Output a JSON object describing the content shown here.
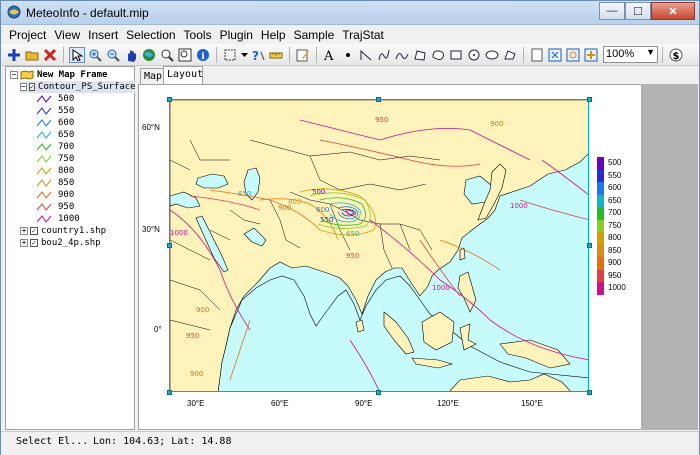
{
  "window": {
    "title": "MeteoInfo - default.mip",
    "buttons": {
      "minimize": "—",
      "maximize": "☐",
      "close": "✕"
    }
  },
  "menu": [
    "Project",
    "View",
    "Insert",
    "Selection",
    "Tools",
    "Plugin",
    "Help",
    "Sample",
    "TrajStat"
  ],
  "toolbar": {
    "zoom_value": "100%",
    "icons": [
      "add-layer-icon",
      "open-icon",
      "remove-layer-icon",
      "select-icon",
      "zoom-in-icon",
      "zoom-out-icon",
      "pan-icon",
      "full-extent-icon",
      "zoom-layer-icon",
      "zoom-select-icon",
      "identify-icon",
      "select-box-icon",
      "dropdown-icon",
      "help-icon",
      "measure-icon",
      "edit-icon",
      "text-icon",
      "point-icon",
      "polyline-icon",
      "freehand-icon",
      "curve-icon",
      "polygon-icon",
      "curve-polygon-icon",
      "rectangle-icon",
      "circle-icon",
      "ellipse-icon",
      "page-setup-icon",
      "page-fit-icon",
      "page-zoom-icon",
      "page-pan-icon",
      "dollar-icon"
    ]
  },
  "legend_tree": {
    "map_frame": "New Map Frame",
    "layers": [
      {
        "name": "Contour_PS_Surface_",
        "selected": true
      },
      {
        "name": "country1.shp",
        "selected": false
      },
      {
        "name": "bou2_4p.shp",
        "selected": false
      }
    ],
    "contour_levels": [
      {
        "value": "500",
        "color": "#7000c0"
      },
      {
        "value": "550",
        "color": "#2a2ad8"
      },
      {
        "value": "600",
        "color": "#1a7ce8"
      },
      {
        "value": "650",
        "color": "#12b8c8"
      },
      {
        "value": "700",
        "color": "#20c020"
      },
      {
        "value": "750",
        "color": "#88cc20"
      },
      {
        "value": "800",
        "color": "#d0a000"
      },
      {
        "value": "850",
        "color": "#e08a10"
      },
      {
        "value": "900",
        "color": "#e07010"
      },
      {
        "value": "950",
        "color": "#e04040"
      },
      {
        "value": "1000",
        "color": "#d0108a"
      }
    ]
  },
  "tabs": {
    "map": "Map",
    "layout": "Layout"
  },
  "map": {
    "lat_labels": [
      "60°N",
      "30°N",
      "0°"
    ],
    "lon_labels": [
      "30°E",
      "60°E",
      "90°E",
      "120°E",
      "150°E"
    ],
    "contour_labels": [
      "950",
      "900",
      "650",
      "500",
      "600",
      "800",
      "900",
      "550",
      "650",
      "950",
      "1000",
      "1000",
      "900",
      "950",
      "900",
      "1000"
    ],
    "colorbar": {
      "labels": [
        "500",
        "550",
        "600",
        "650",
        "700",
        "750",
        "800",
        "850",
        "900",
        "950",
        "1000"
      ],
      "colors": [
        "#7000c0",
        "#2a2ad8",
        "#1a7ce8",
        "#12b8c8",
        "#20c020",
        "#88cc20",
        "#d0a000",
        "#e08a10",
        "#e07010",
        "#e04040",
        "#d0108a"
      ]
    },
    "colors": {
      "ocean": "#c6fafb",
      "land": "#fef3ba"
    }
  },
  "status": {
    "tool": "Select El...",
    "coords": "Lon: 104.63; Lat: 14.88"
  }
}
